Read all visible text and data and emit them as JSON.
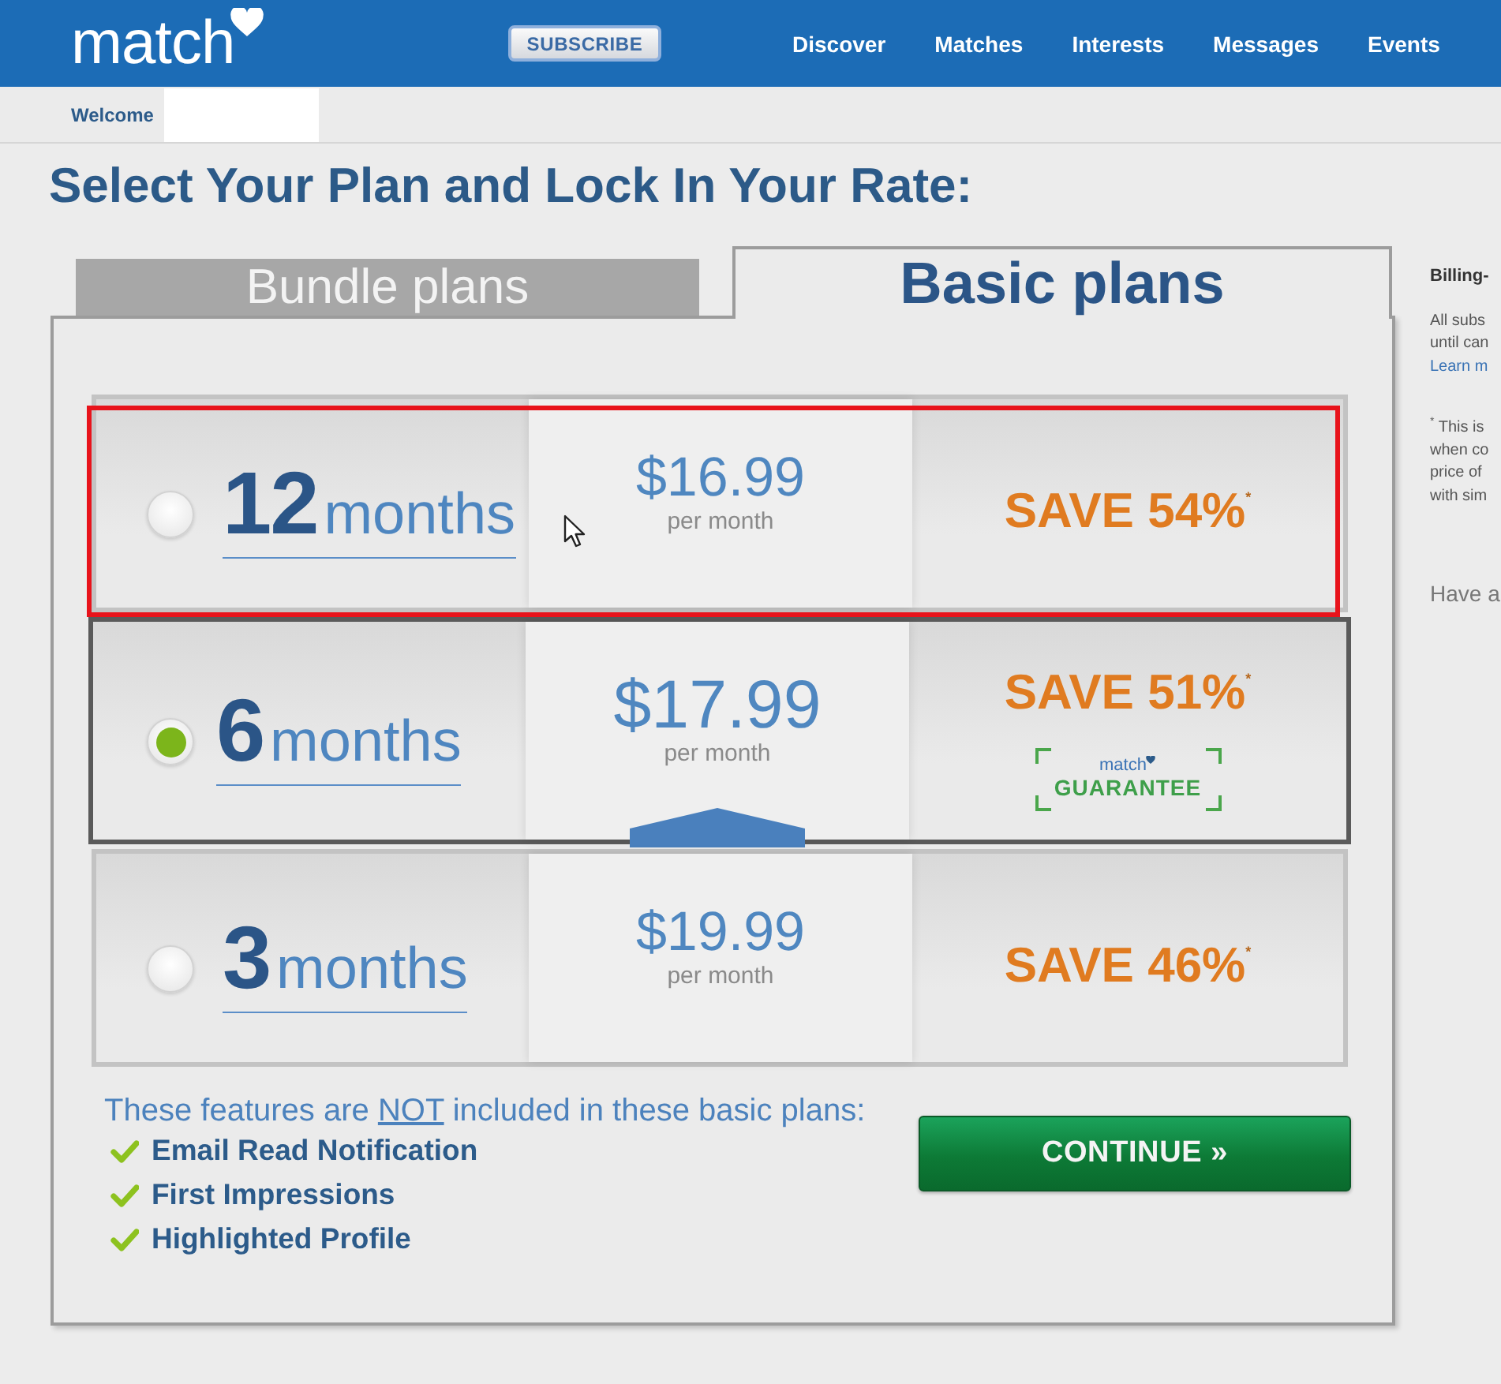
{
  "header": {
    "logo": "match",
    "subscribe_button": "SUBSCRIBE",
    "nav": [
      "Discover",
      "Matches",
      "Interests",
      "Messages",
      "Events"
    ]
  },
  "welcome_bar": {
    "greeting": "Welcome"
  },
  "page_title": "Select Your Plan and Lock In Your Rate:",
  "tabs": [
    {
      "label": "Bundle plans",
      "selected": false
    },
    {
      "label": "Basic plans",
      "selected": true
    }
  ],
  "plans": [
    {
      "number": "12",
      "unit": "months",
      "price": "$16.99",
      "price_note": "per month",
      "savings": "SAVE 54%$^{*}$",
      "selected": false,
      "highlighted": true
    },
    {
      "number": "6",
      "unit": "months",
      "price": "$17.99",
      "price_note": "per month",
      "savings": "SAVE 51%$^{*}$",
      "selected": true,
      "highlighted": false,
      "guarantee": {
        "brand": "match",
        "label": "GUARANTEE"
      }
    },
    {
      "number": "3",
      "unit": "months",
      "price": "$19.99",
      "price_note": "per month",
      "savings": "SAVE 46%$^{*}$",
      "selected": false,
      "highlighted": false
    }
  ],
  "features_note": {
    "before": "These features are",
    "underlined": "NOT",
    "after": "included in these basic plans:"
  },
  "features": [
    "Email Read Notification",
    "First Impressions",
    "Highlighted Profile"
  ],
  "continue_button": "CONTINUE »",
  "sidebar": {
    "heading": "Billing-",
    "note_lines": [
      "All subs",
      "until can"
    ],
    "link": "Learn m",
    "footnote_lines": [
      "$^{*}$ This is",
      "when co",
      "price of",
      "with sim"
    ],
    "question": "Have a"
  }
}
